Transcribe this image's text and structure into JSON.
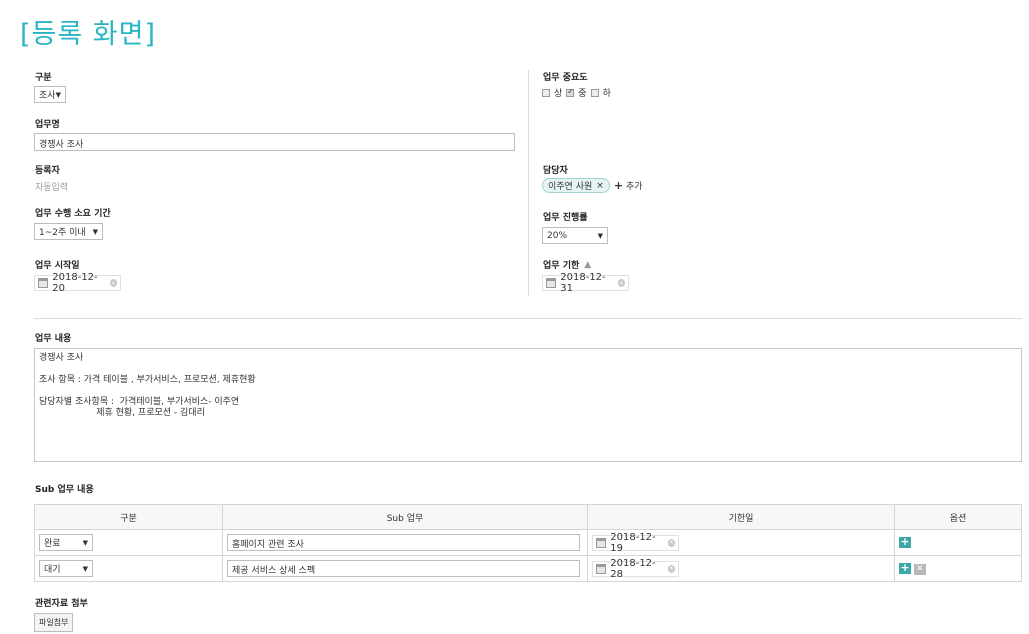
{
  "page_title": "[등록 화면]",
  "category": {
    "label": "구분",
    "value": "조사"
  },
  "importance": {
    "label": "업무 중요도",
    "options": [
      {
        "label": "상",
        "checked": false
      },
      {
        "label": "중",
        "checked": true
      },
      {
        "label": "하",
        "checked": false
      }
    ]
  },
  "task_name": {
    "label": "업무명",
    "value": "경쟁사 조사"
  },
  "registrant": {
    "label": "등록자",
    "value": "자동입력"
  },
  "assignee": {
    "label": "담당자",
    "chip": "이주연 사원",
    "add_label": "추가"
  },
  "duration": {
    "label": "업무 수행 소요 기간",
    "value": "1~2주 이내"
  },
  "progress": {
    "label": "업무 진행률",
    "value": "20%"
  },
  "start_date": {
    "label": "업무 시작일",
    "value": "2018-12-20"
  },
  "due_date": {
    "label": "업무 기한",
    "value": "2018-12-31"
  },
  "content": {
    "label": "업무 내용",
    "lines": [
      "경쟁사 조사",
      "",
      "조사 항목 : 가격 테이블 , 부가서비스, 프로모션, 제휴현황",
      "",
      "담당자별 조사항목 :  가격테이블, 부가서비스- 이주연",
      "                    제휴 현황, 프로모션 - 김대리"
    ]
  },
  "sub_tasks": {
    "label": "Sub 업무 내용",
    "headers": [
      "구분",
      "Sub 업무",
      "기한일",
      "옵션"
    ],
    "rows": [
      {
        "status": "완료",
        "task": "홈페이지 관련 조사",
        "date": "2018-12-19"
      },
      {
        "status": "대기",
        "task": "제공 서비스 상세 스펙",
        "date": "2018-12-28"
      }
    ]
  },
  "attachment": {
    "label": "관련자료 첨부",
    "button": "파일첨부"
  }
}
